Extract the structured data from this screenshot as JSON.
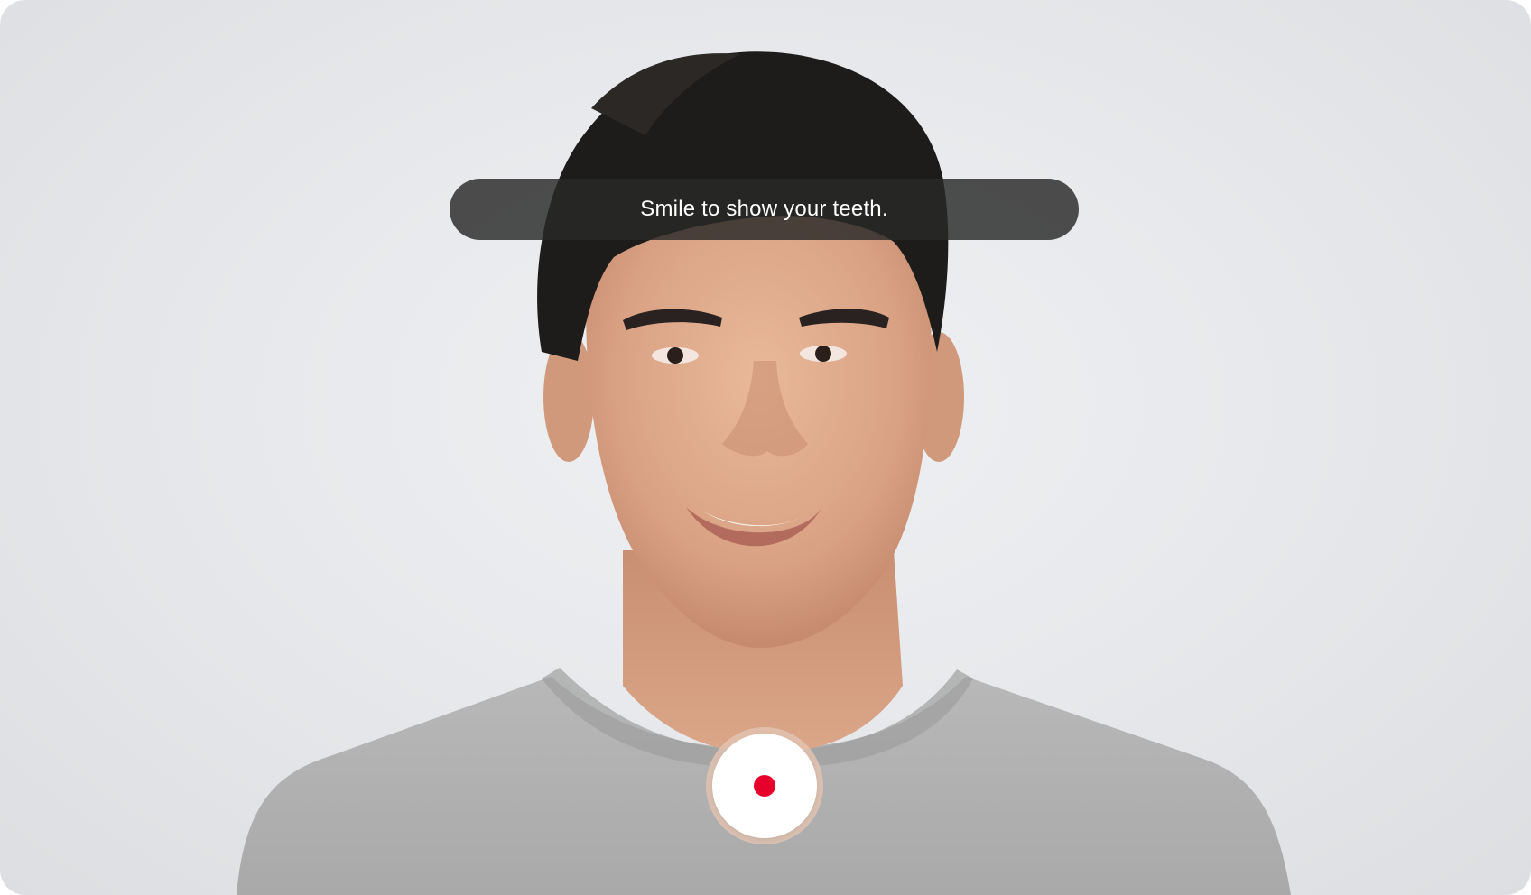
{
  "prompt": {
    "text": "Smile to show your teeth."
  },
  "camera": {
    "subject": "person-smiling-portrait"
  },
  "record_button": {
    "icon": "record-dot-icon",
    "dot_color": "#e8002d"
  }
}
